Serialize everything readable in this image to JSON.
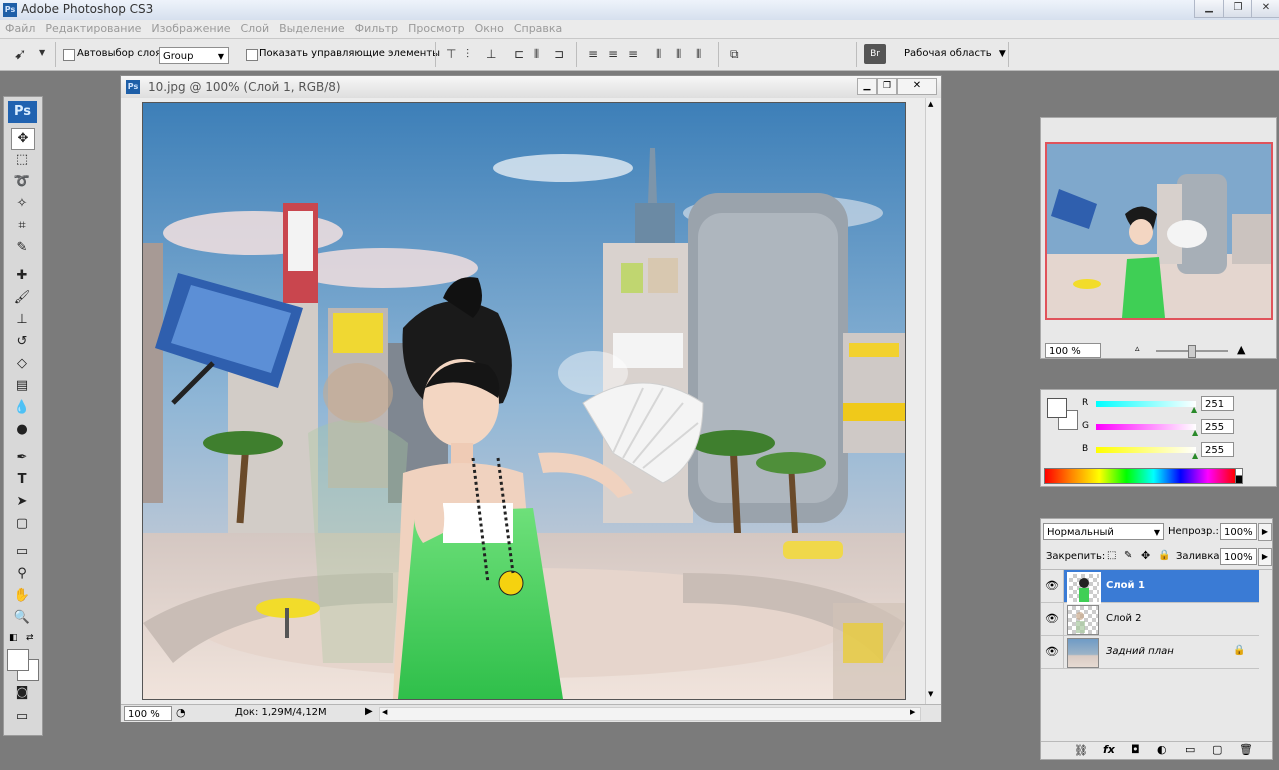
{
  "app": {
    "title": "Adobe Photoshop CS3",
    "ps_logo": "Ps"
  },
  "menu": [
    "Файл",
    "Редактирование",
    "Изображение",
    "Слой",
    "Выделение",
    "Фильтр",
    "Просмотр",
    "Окно",
    "Справка"
  ],
  "options": {
    "auto_select_label": "Автовыбор слоя",
    "auto_select_value": "Group",
    "show_controls_label": "Показать управляющие элементы",
    "workspace_label": "Рабочая область"
  },
  "document": {
    "title": "10.jpg @ 100% (Слой 1, RGB/8)",
    "zoom": "100 %",
    "doc_size": "Док: 1,29M/4,12M"
  },
  "navigator": {
    "zoom": "100 %"
  },
  "color": {
    "channels": [
      {
        "label": "R",
        "value": "251"
      },
      {
        "label": "G",
        "value": "255"
      },
      {
        "label": "B",
        "value": "255"
      }
    ]
  },
  "layers": {
    "blend_mode": "Нормальный",
    "opacity_label": "Непрозр.:",
    "opacity_value": "100%",
    "lock_label": "Закрепить:",
    "fill_label": "Заливка:",
    "fill_value": "100%",
    "items": [
      {
        "name": "Слой 1",
        "selected": true
      },
      {
        "name": "Слой 2",
        "selected": false
      },
      {
        "name": "Задний план",
        "selected": false,
        "locked": true
      }
    ]
  },
  "colors": {
    "selection": "#3a7bd5",
    "ps_blue": "#2062b0"
  }
}
